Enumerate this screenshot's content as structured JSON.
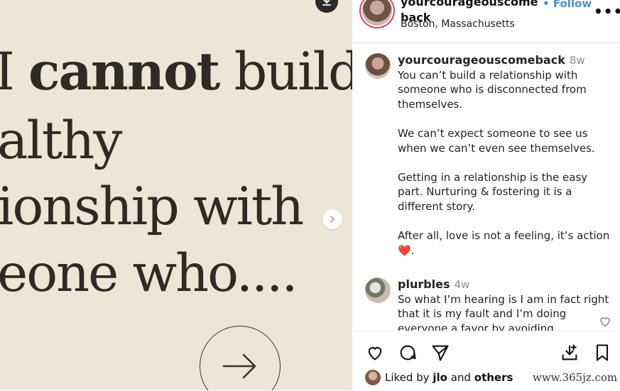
{
  "post": {
    "quote_lines": [
      {
        "bold": "cannot",
        "rest": " build",
        "pre": "I "
      },
      {
        "bold": "",
        "rest": "althy",
        "pre": ""
      },
      {
        "bold": "",
        "rest": "ionship with",
        "pre": ""
      },
      {
        "bold": "",
        "rest": "eone who....",
        "pre": ""
      }
    ]
  },
  "header": {
    "username": "yourcourageouscomeback",
    "follow_label": "Follow",
    "location": "Boston, Massachusetts",
    "more_label": "•••"
  },
  "comments": [
    {
      "username": "yourcourageouscomeback",
      "time": "8w",
      "paragraphs": [
        "You can’t build a relationship with someone who is disconnected from themselves.",
        "We can’t expect someone to see us when we can’t even see themselves.",
        "Getting in a relationship is the easy part. Nurturing & fostering it is a different story.",
        "After all, love is not a feeling, it’s action ❤️."
      ]
    },
    {
      "username": "plurbles",
      "time": "4w",
      "paragraphs": [
        "So what I’m hearing is I am in fact right that it is my fault and I’m doing everyone a favor by avoiding"
      ]
    }
  ],
  "liked_by": {
    "prefix": "Liked by",
    "user": "jlo",
    "mid": "and",
    "others": "others"
  },
  "watermark": "www.365jz.com",
  "colors": {
    "accent": "#4a8cd6",
    "heart": "#e0245e",
    "image_bg": "#ebe6d7"
  }
}
